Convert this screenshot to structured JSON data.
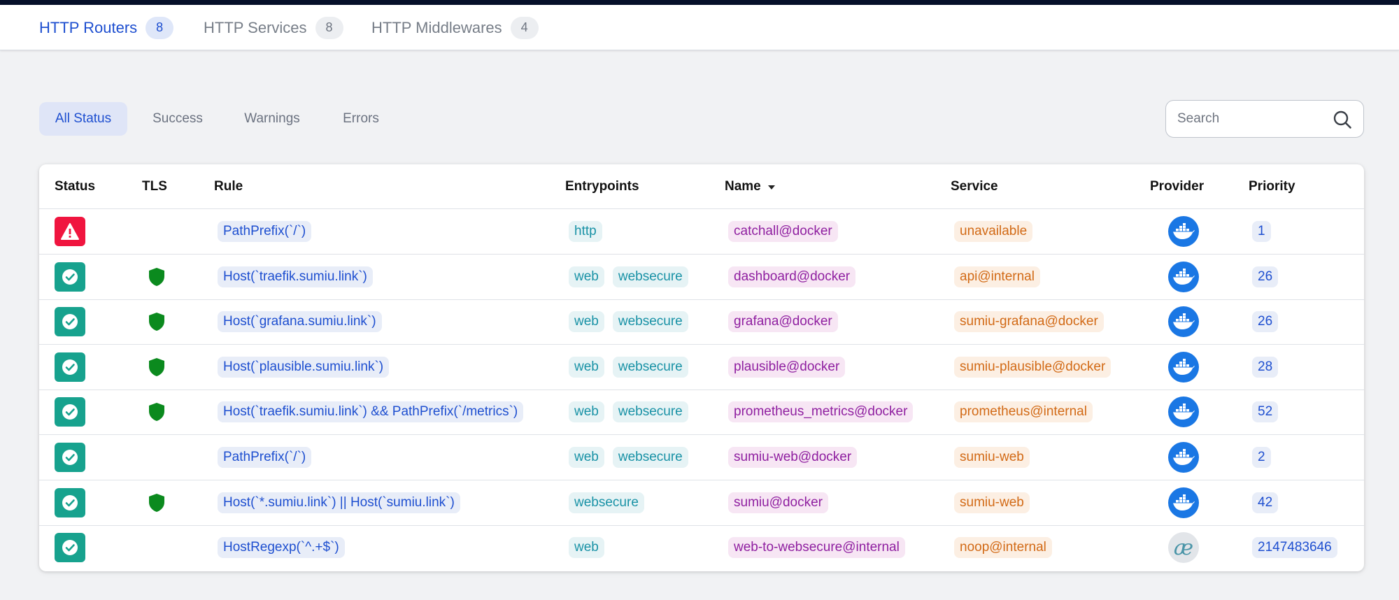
{
  "tabs": [
    {
      "label": "HTTP Routers",
      "count": "8"
    },
    {
      "label": "HTTP Services",
      "count": "8"
    },
    {
      "label": "HTTP Middlewares",
      "count": "4"
    }
  ],
  "filters": [
    "All Status",
    "Success",
    "Warnings",
    "Errors"
  ],
  "search": {
    "placeholder": "Search"
  },
  "columns": [
    "Status",
    "TLS",
    "Rule",
    "Entrypoints",
    "Name",
    "Service",
    "Provider",
    "Priority"
  ],
  "rows": [
    {
      "status": "error",
      "tls": false,
      "rule": "PathPrefix(`/`)",
      "entrypoints": [
        "http"
      ],
      "name": "catchall@docker",
      "service": "unavailable",
      "provider": "docker-icon",
      "priority": "1"
    },
    {
      "status": "success",
      "tls": true,
      "rule": "Host(`traefik.sumiu.link`)",
      "entrypoints": [
        "web",
        "websecure"
      ],
      "name": "dashboard@docker",
      "service": "api@internal",
      "provider": "docker-icon",
      "priority": "26"
    },
    {
      "status": "success",
      "tls": true,
      "rule": "Host(`grafana.sumiu.link`)",
      "entrypoints": [
        "web",
        "websecure"
      ],
      "name": "grafana@docker",
      "service": "sumiu-grafana@docker",
      "provider": "docker-icon",
      "priority": "26"
    },
    {
      "status": "success",
      "tls": true,
      "rule": "Host(`plausible.sumiu.link`)",
      "entrypoints": [
        "web",
        "websecure"
      ],
      "name": "plausible@docker",
      "service": "sumiu-plausible@docker",
      "provider": "docker-icon",
      "priority": "28"
    },
    {
      "status": "success",
      "tls": true,
      "rule": "Host(`traefik.sumiu.link`) && PathPrefix(`/metrics`)",
      "entrypoints": [
        "web",
        "websecure"
      ],
      "name": "prometheus_metrics@docker",
      "service": "prometheus@internal",
      "provider": "docker-icon",
      "priority": "52"
    },
    {
      "status": "success",
      "tls": false,
      "rule": "PathPrefix(`/`)",
      "entrypoints": [
        "web",
        "websecure"
      ],
      "name": "sumiu-web@docker",
      "service": "sumiu-web",
      "provider": "docker-icon",
      "priority": "2"
    },
    {
      "status": "success",
      "tls": true,
      "rule": "Host(`*.sumiu.link`) || Host(`sumiu.link`)",
      "entrypoints": [
        "websecure"
      ],
      "name": "sumiu@docker",
      "service": "sumiu-web",
      "provider": "docker-icon",
      "priority": "42"
    },
    {
      "status": "success",
      "tls": false,
      "rule": "HostRegexp(`^.+$`)",
      "entrypoints": [
        "web"
      ],
      "name": "web-to-websecure@internal",
      "service": "noop@internal",
      "provider": "internal-provider-icon",
      "priority": "2147483646"
    }
  ],
  "colors": {
    "accent": "#1e4fd0",
    "success": "#17a28e",
    "error": "#f0153f",
    "tls_shield": "#0b8a1e",
    "docker": "#1a77e4"
  }
}
